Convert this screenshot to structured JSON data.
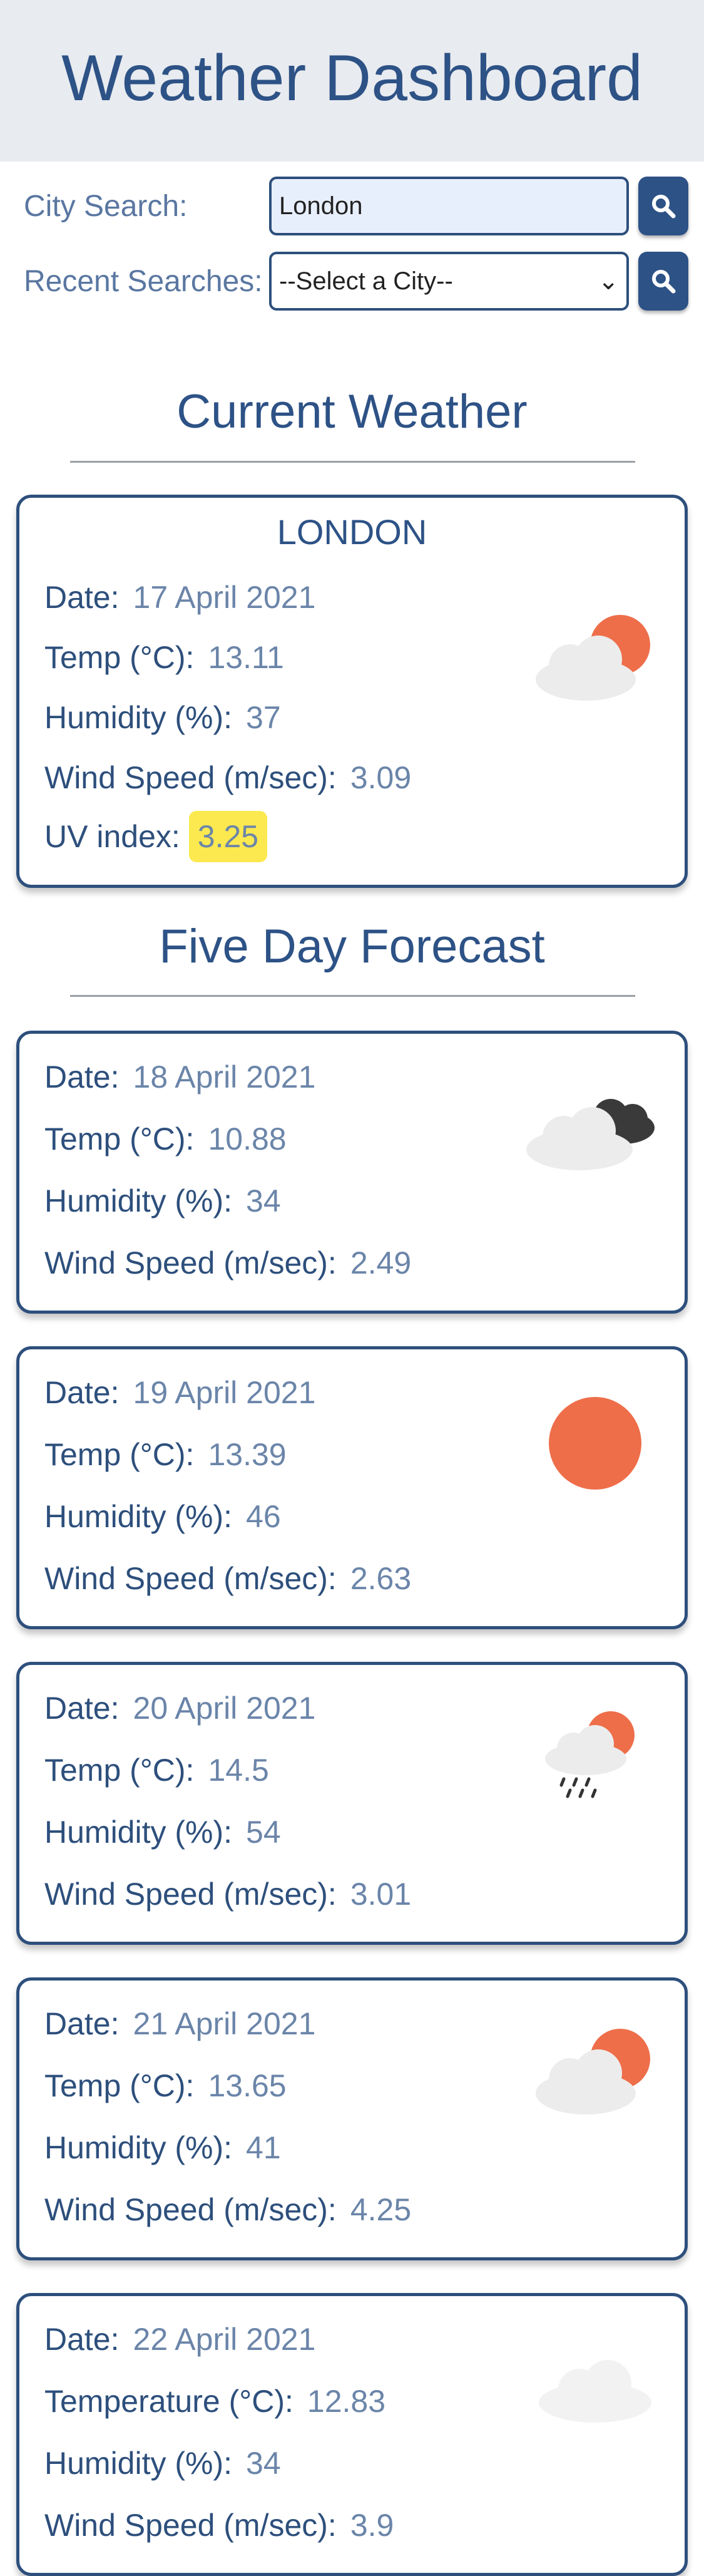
{
  "header": {
    "title": "Weather Dashboard"
  },
  "search": {
    "city_label": "City Search:",
    "city_value": "London",
    "recent_label": "Recent Searches:",
    "recent_selected": "--Select a City--"
  },
  "current": {
    "section_title": "Current Weather",
    "city": "LONDON",
    "date_label": "Date:",
    "date": "17 April 2021",
    "temp_label": "Temp (°C):",
    "temp": "13.11",
    "humidity_label": "Humidity (%):",
    "humidity": "37",
    "wind_label": "Wind Speed (m/sec):",
    "wind": "3.09",
    "uv_label": "UV index:",
    "uv": "3.25",
    "icon": "partly-cloudy-sun-icon"
  },
  "forecast": {
    "section_title": "Five Day Forecast",
    "days": [
      {
        "date_label": "Date:",
        "date": "18 April 2021",
        "temp_label": "Temp (°C):",
        "temp": "10.88",
        "humidity_label": "Humidity (%):",
        "humidity": "34",
        "wind_label": "Wind Speed (m/sec):",
        "wind": "2.49",
        "icon": "broken-clouds-icon"
      },
      {
        "date_label": "Date:",
        "date": "19 April 2021",
        "temp_label": "Temp (°C):",
        "temp": "13.39",
        "humidity_label": "Humidity (%):",
        "humidity": "46",
        "wind_label": "Wind Speed (m/sec):",
        "wind": "2.63",
        "icon": "sun-icon"
      },
      {
        "date_label": "Date:",
        "date": "20 April 2021",
        "temp_label": "Temp (°C):",
        "temp": "14.5",
        "humidity_label": "Humidity (%):",
        "humidity": "54",
        "wind_label": "Wind Speed (m/sec):",
        "wind": "3.01",
        "icon": "sun-rain-cloud-icon"
      },
      {
        "date_label": "Date:",
        "date": "21 April 2021",
        "temp_label": "Temp (°C):",
        "temp": "13.65",
        "humidity_label": "Humidity (%):",
        "humidity": "41",
        "wind_label": "Wind Speed (m/sec):",
        "wind": "4.25",
        "icon": "partly-cloudy-sun-icon"
      },
      {
        "date_label": "Date:",
        "date": "22 April 2021",
        "temp_label": "Temperature (°C):",
        "temp": "12.83",
        "humidity_label": "Humidity (%):",
        "humidity": "34",
        "wind_label": "Wind Speed (m/sec):",
        "wind": "3.9",
        "icon": "cloud-icon"
      }
    ]
  },
  "colors": {
    "primary": "#2d5286",
    "value": "#6b85a9",
    "uv_badge": "#fce94f",
    "sun": "#ee6e4a",
    "header_bg": "#e8ebef"
  }
}
